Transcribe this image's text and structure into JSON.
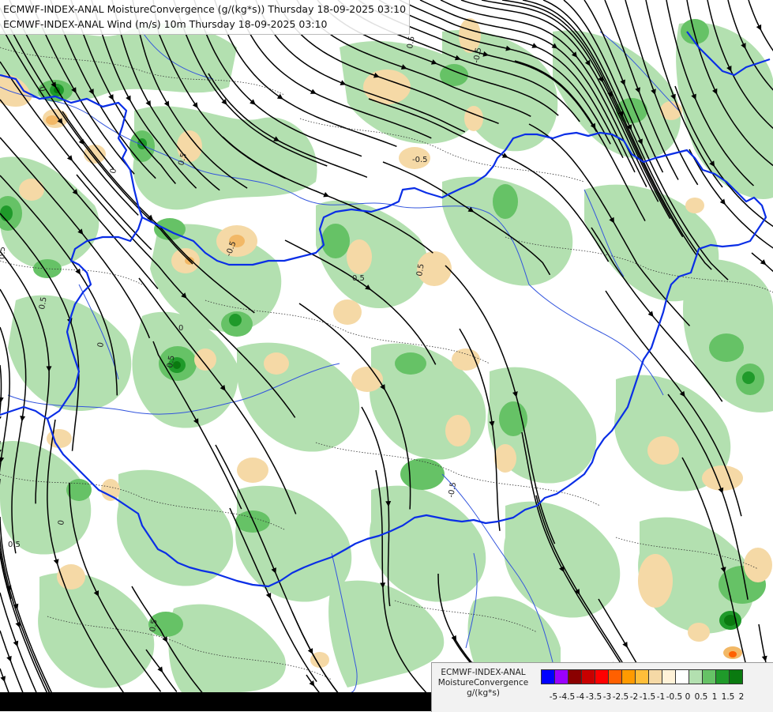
{
  "header": {
    "line1": "ECMWF-INDEX-ANAL MoistureConvergence (g/(kg*s)) Thursday 18-09-2025 03:10",
    "line2": "ECMWF-INDEX-ANAL Wind (m/s) 10m Thursday 18-09-2025 03:10"
  },
  "map": {
    "contour_labels": [
      "0",
      "0.5",
      "-0.5",
      "0.5",
      "0",
      "0.5",
      "-0.5",
      "0.5",
      "0",
      "0.5",
      "0",
      "-0.5",
      "0.5",
      "0.5",
      "0",
      "0.5",
      "0.5",
      "-0.5"
    ],
    "colors": {
      "positive_light": "#b3e0b0",
      "positive_mid": "#66c266",
      "positive_dark": "#1f9a2a",
      "positive_max": "#0a7a10",
      "negative_light": "#f5d9a6",
      "negative_mid": "#f2b866",
      "border": "#0a2ee6",
      "river": "#3355dd",
      "streamline": "#000000"
    }
  },
  "legend": {
    "name_lines": [
      "ECMWF-INDEX-ANAL",
      "MoistureConvergence",
      "g/(kg*s)"
    ],
    "colors": [
      "#0000ff",
      "#9b00ff",
      "#8a0000",
      "#c80000",
      "#ff0000",
      "#ff6000",
      "#ff9a00",
      "#ffbe3a",
      "#f5d9a6",
      "#fff2d8",
      "#ffffff",
      "#b3e0b0",
      "#66c266",
      "#1f9a2a",
      "#0a7a10"
    ],
    "ticks": [
      "-5",
      "-4.5",
      "-4",
      "-3.5",
      "-3",
      "-2.5",
      "-2",
      "-1.5",
      "-1",
      "-0.5",
      "0",
      "0.5",
      "1",
      "1.5",
      "2"
    ]
  }
}
